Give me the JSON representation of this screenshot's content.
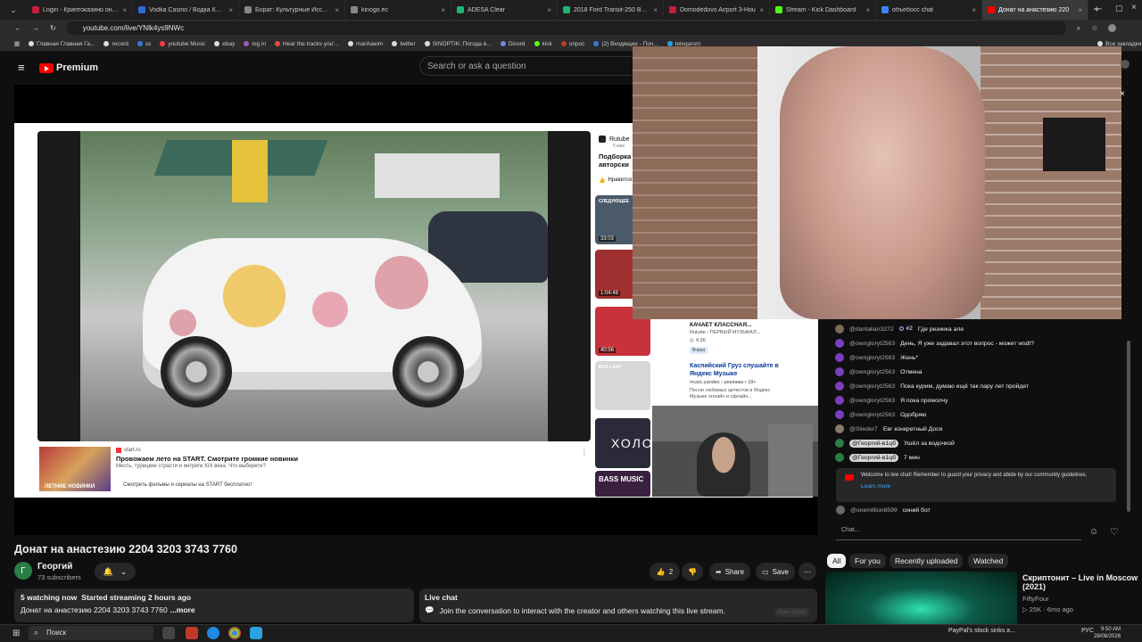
{
  "browser": {
    "tabs": [
      {
        "title": "Login - Криптоказино онлай",
        "color": "#c41e3a"
      },
      {
        "title": "Vodka Casino / Водка Казино",
        "color": "#2f6bd8"
      },
      {
        "title": "Борат: Культурные Исследо",
        "color": "#888888"
      },
      {
        "title": "kinogo.ec",
        "color": "#888888"
      },
      {
        "title": "ADESA Clear",
        "color": "#21b573"
      },
      {
        "title": "2018 Ford Transit-250 Base",
        "color": "#21b573"
      },
      {
        "title": "Domodedovo Airport 3-Hou",
        "color": "#c41e3a"
      },
      {
        "title": "Stream - Kick Dashboard",
        "color": "#53fc18"
      },
      {
        "title": "объебосс chat",
        "color": "#3a86ff"
      },
      {
        "title": "Донат на анастезию 220",
        "color": "#ff0000"
      }
    ],
    "url": "youtube.com/live/YNlk4ys9NWc",
    "bookmarks": [
      "Главная Главная Га...",
      "record",
      "ss",
      "youtube Music",
      "ebay",
      "log in",
      "Hear the tracks you'...",
      "manhaeim",
      "twitter",
      "SINOPTIK: Погода в...",
      "Dicord",
      "kick",
      "опрос",
      "(2) Входящие - Поч...",
      "telegarom",
      "Все закладки"
    ]
  },
  "youtube": {
    "logo_text": "Premium",
    "search_placeholder": "Search or ask a question"
  },
  "player": {
    "ad_source": "start.ru",
    "ad_title": "Провожаем лето на START. Смотрите громкие новинки",
    "ad_desc": "Месть, турецкие страсти и интриги XIX века. Что выберете?",
    "ad_footer": "Смотреть фильмы и сериалы на START бесплатно!",
    "ad_thumb_label": "ЛЕТНИЕ НОВИНКИ",
    "side_brand": "Rutube",
    "side_date": "5 мая",
    "side_title": "Подборка авторски",
    "side_like": "Нравится",
    "side_items": [
      {
        "duration": "33:03",
        "label": "СЛЕДУЮЩЕЕ",
        "color": "#4a5a6a"
      },
      {
        "duration": "1:04:48",
        "label": "",
        "color": "#a03030"
      },
      {
        "duration": "40:56",
        "label": "",
        "color": "#c8323a"
      },
      {
        "duration": "",
        "label": "MUZ.LANT",
        "color": "#d7d7d7"
      }
    ],
    "side_item3_title": "КАЧАЕТ КЛАССНАЯ...",
    "side_item3_sub": "Rutube › ПЕРВЫЙ МУЗЫКАЛ...",
    "side_item3_views": "4,3K",
    "side_item3_badge": "Вчера",
    "side_item4_title": "Каспийский Груз слушайте в Яндекс Музыке",
    "side_item4_sub": "music.yandex › реклама • 18+",
    "side_item4_desc": "Песни любимых артистов в Яндекс Музыке онлайн и офлайн...",
    "side_item5_label": "ХОЛО",
    "side_item6_label": "BASS MUSIC"
  },
  "video": {
    "title": "Донат на анастезию 2204 3203 3743 7760",
    "channel": "Георгий",
    "channel_initial": "Г",
    "subscribers": "73 subscribers",
    "likes": "2",
    "share": "Share",
    "save": "Save",
    "watching": "5 watching now",
    "started": "Started streaming 2 hours ago",
    "desc_line": "Донат на анастезию 2204 3203 3743 7760",
    "more": "...more",
    "live_chat_title": "Live chat",
    "live_chat_text": "Join the conversation to interact with the creator and others watching this live stream.",
    "open_panel": "Open panel"
  },
  "chat": {
    "messages": [
      {
        "author": "@dantalian3272",
        "badge": "#2",
        "text": "Где резинка але",
        "color": "#7a6a5a"
      },
      {
        "author": "@owngloryt2563",
        "badge": "",
        "text": "День, Я уже задавал этот вопрос - может wsdt?",
        "color": "#7b3fbf"
      },
      {
        "author": "@owngloryt2563",
        "badge": "",
        "text": "Жень*",
        "color": "#7b3fbf"
      },
      {
        "author": "@owngloryt2563",
        "badge": "",
        "text": "Отмена",
        "color": "#7b3fbf"
      },
      {
        "author": "@owngloryt2563",
        "badge": "",
        "text": "Пока курим, думаю ещё так пару лет пройдет",
        "color": "#7b3fbf"
      },
      {
        "author": "@owngloryt2563",
        "badge": "",
        "text": "Я пока промолчу",
        "color": "#7b3fbf"
      },
      {
        "author": "@owngloryt2563",
        "badge": "",
        "text": "Одобряю",
        "color": "#7b3fbf"
      },
      {
        "author": "@Slieder7",
        "badge": "",
        "text": "Евг конкретный Дося",
        "color": "#8a7a6a"
      },
      {
        "author": "@Георгий-в1цб",
        "badge": "",
        "text": "Ушёл за водочкой",
        "color": "#2a7e45",
        "owner": true
      },
      {
        "author": "@Георгий-в1цб",
        "badge": "",
        "text": "7 мин",
        "color": "#2a7e45",
        "owner": true
      }
    ],
    "welcome": "Welcome to live chat! Remember to guard your privacy and abide by our community guidelines.",
    "learn_more": "Learn more",
    "last_author": "@onemillion6599",
    "last_text": "синий бот",
    "input_placeholder": "Chat..."
  },
  "chips": [
    "All",
    "For you",
    "Recently uploaded",
    "Watched"
  ],
  "recommended": {
    "title": "Скриптонит – Live in Moscow (2021)",
    "channel": "FiftyFour",
    "meta": "25K · 6mo ago"
  },
  "taskbar": {
    "search": "Поиск",
    "news": "PayPal's stock sinks a...",
    "lang": "РУС",
    "time": "9:50 AM",
    "date": "28/08/2026"
  }
}
